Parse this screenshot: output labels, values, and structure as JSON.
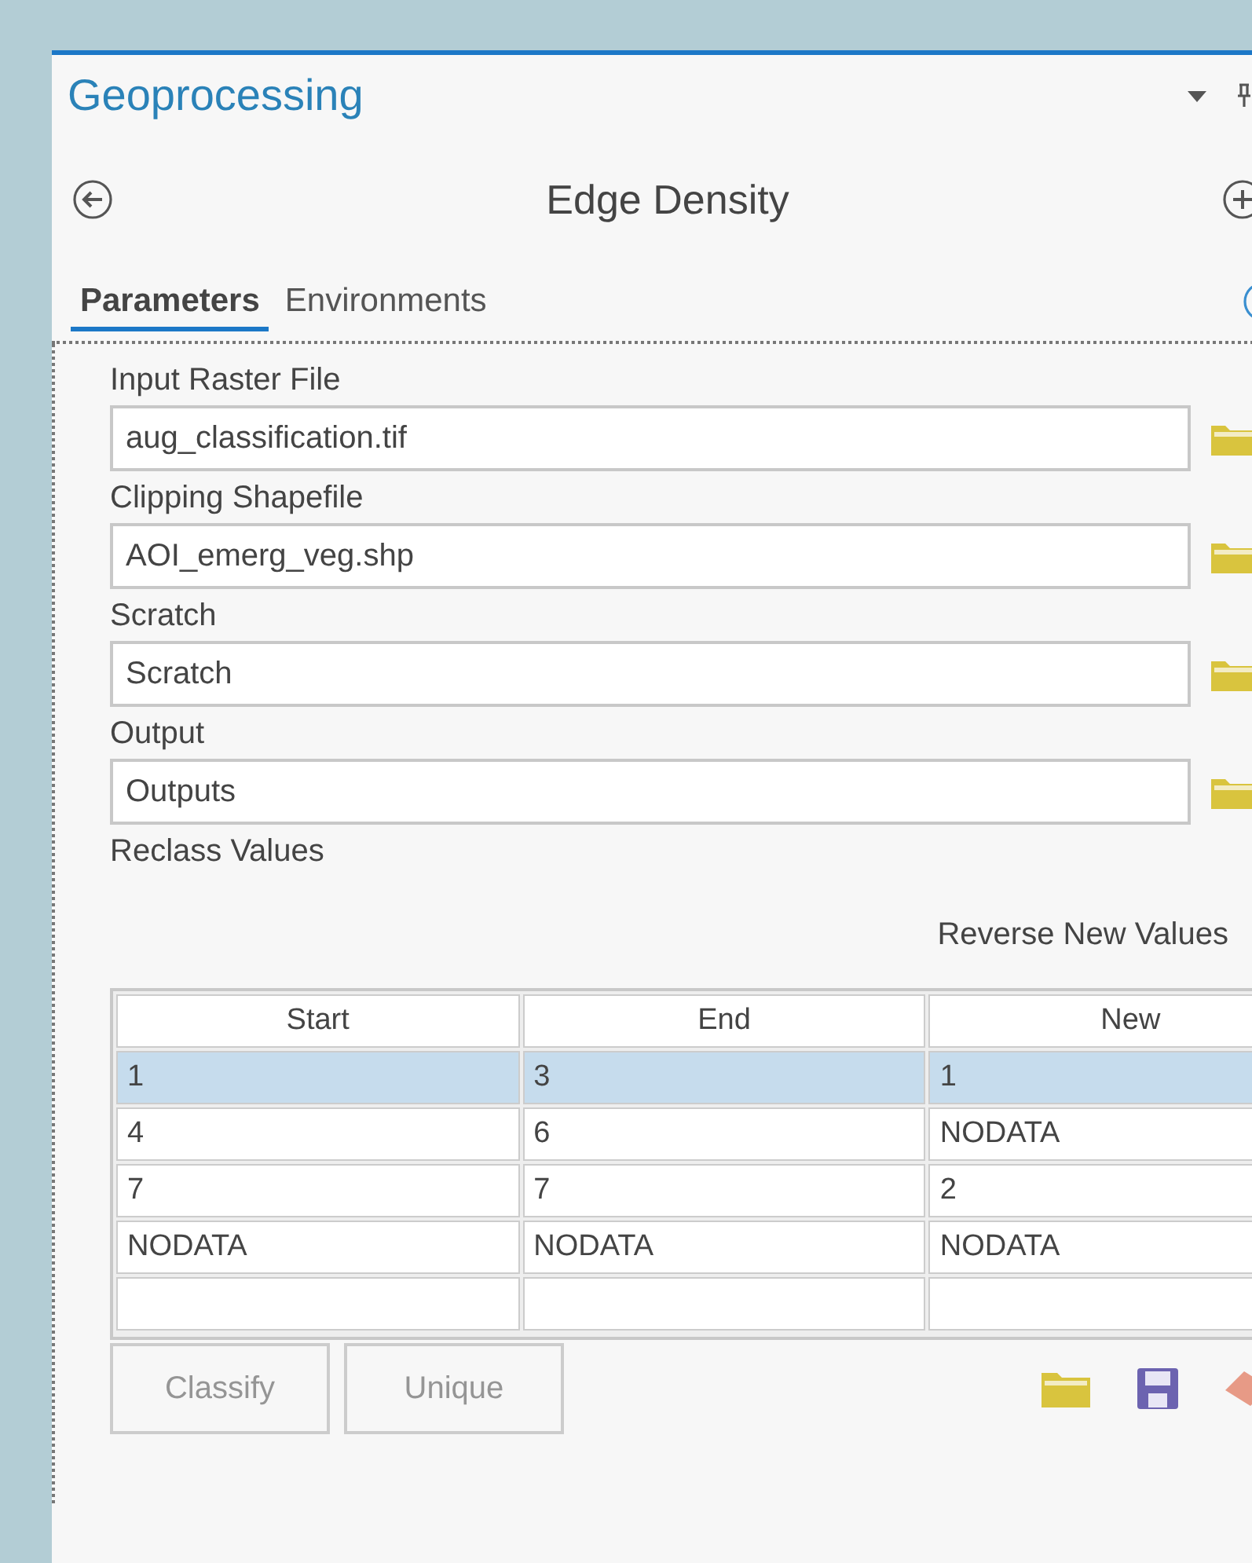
{
  "pane": {
    "title": "Geoprocessing"
  },
  "tool": {
    "title": "Edge Density"
  },
  "tabs": [
    {
      "label": "Parameters",
      "selected": true
    },
    {
      "label": "Environments",
      "selected": false
    }
  ],
  "parameters": [
    {
      "label": "Input Raster File",
      "value": "aug_classification.tif"
    },
    {
      "label": "Clipping Shapefile",
      "value": "AOI_emerg_veg.shp"
    },
    {
      "label": "Scratch",
      "value": "Scratch"
    },
    {
      "label": "Output",
      "value": "Outputs"
    }
  ],
  "reclass": {
    "label": "Reclass Values",
    "reverse_button": "Reverse New Values",
    "columns": [
      "Start",
      "End",
      "New"
    ],
    "rows": [
      {
        "cells": [
          "1",
          "3",
          "1"
        ],
        "selected": true
      },
      {
        "cells": [
          "4",
          "6",
          "NODATA"
        ],
        "selected": false
      },
      {
        "cells": [
          "7",
          "7",
          "2"
        ],
        "selected": false
      },
      {
        "cells": [
          "NODATA",
          "NODATA",
          "NODATA"
        ],
        "selected": false
      }
    ]
  },
  "buttons": [
    {
      "label": "Classify",
      "disabled": true
    },
    {
      "label": "Unique",
      "disabled": true
    }
  ]
}
